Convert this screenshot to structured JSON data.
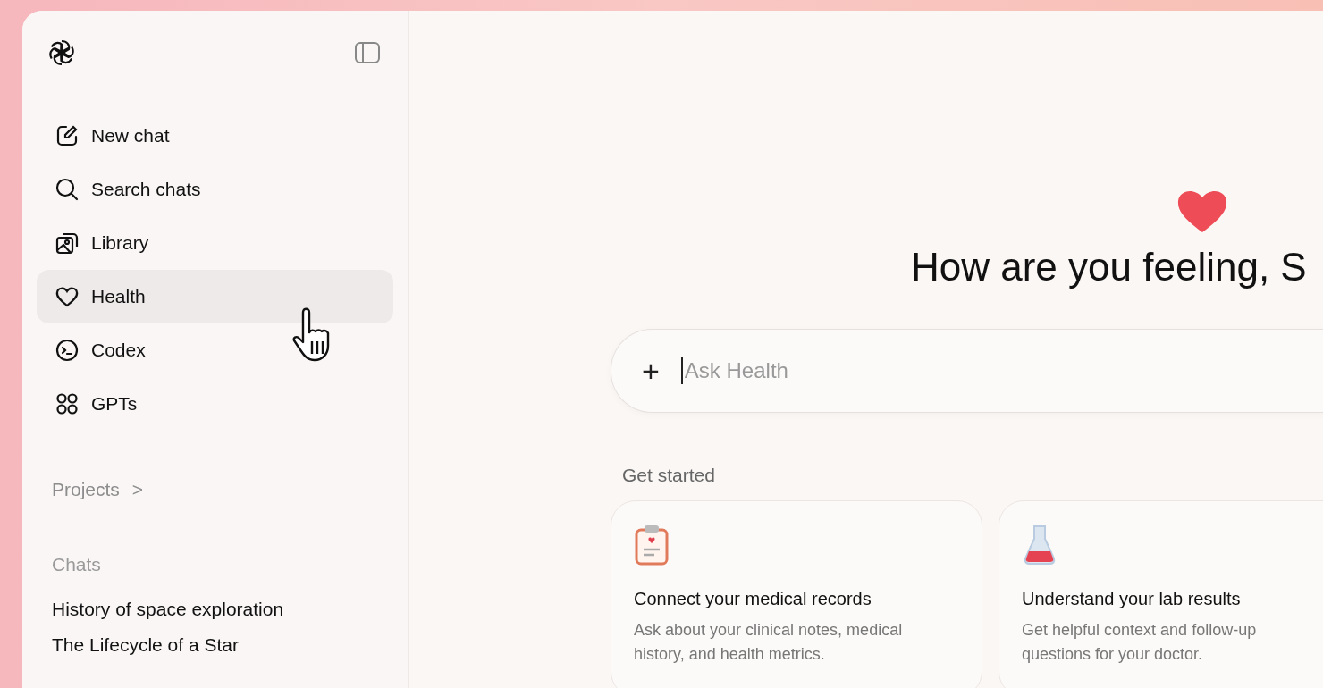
{
  "sidebar": {
    "items": [
      {
        "kind": "new-chat",
        "label": "New chat",
        "selected": false
      },
      {
        "kind": "search",
        "label": "Search chats",
        "selected": false
      },
      {
        "kind": "library",
        "label": "Library",
        "selected": false
      },
      {
        "kind": "health",
        "label": "Health",
        "selected": true
      },
      {
        "kind": "codex",
        "label": "Codex",
        "selected": false
      },
      {
        "kind": "gpts",
        "label": "GPTs",
        "selected": false
      }
    ],
    "projects": {
      "label": "Projects",
      "chevron": ">"
    },
    "chats_heading": "Chats",
    "chats": [
      "History of space exploration",
      "The Lifecycle of a Star"
    ]
  },
  "main": {
    "heading": "How are you feeling, S",
    "composer": {
      "add": "+",
      "placeholder": "Ask Health"
    },
    "section_title": "Get started",
    "cards": [
      {
        "kind": "records",
        "title": "Connect your medical records",
        "body": "Ask about your clinical notes, medical history, and health metrics."
      },
      {
        "kind": "lab",
        "title": "Understand your lab results",
        "body": "Get helpful context and follow-up questions for your doctor."
      }
    ]
  }
}
